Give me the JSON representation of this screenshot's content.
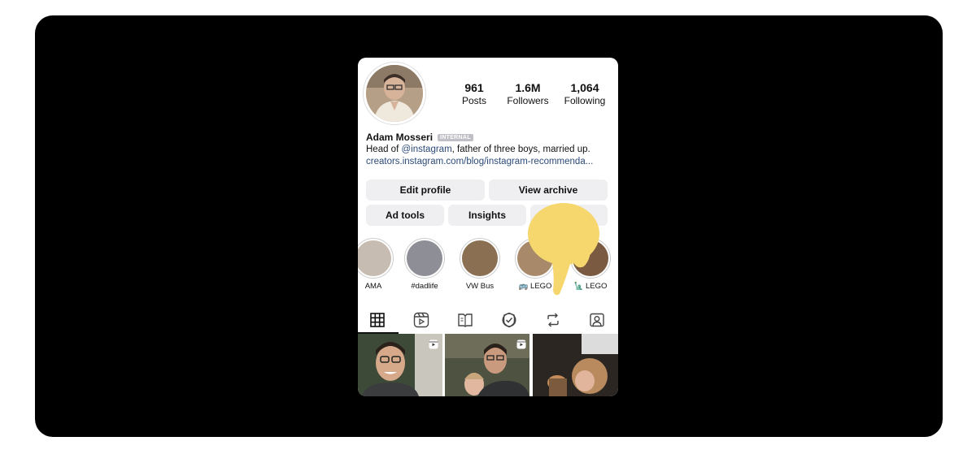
{
  "profile": {
    "name": "Adam Mosseri",
    "badge": "INTERNAL",
    "bio_prefix": "Head of ",
    "bio_mention": "@instagram",
    "bio_suffix": ", father of three boys, married up.",
    "link": "creators.instagram.com/blog/instagram-recommenda..."
  },
  "stats": [
    {
      "value": "961",
      "label": "Posts"
    },
    {
      "value": "1.6M",
      "label": "Followers"
    },
    {
      "value": "1,064",
      "label": "Following"
    }
  ],
  "buttons": {
    "edit_profile": "Edit profile",
    "view_archive": "View archive",
    "ad_tools": "Ad tools",
    "insights": "Insights"
  },
  "highlights": [
    {
      "label": "AMA"
    },
    {
      "label": "#dadlife"
    },
    {
      "label": "VW Bus"
    },
    {
      "label": "🚌 LEGO"
    },
    {
      "label": "🗽 LEGO"
    }
  ],
  "tabs": [
    "grid-icon",
    "reels-icon",
    "guides-icon",
    "collab-icon",
    "reposts-icon",
    "tagged-icon"
  ],
  "colors": {
    "link": "#2b4a78",
    "button_bg": "#efeff1",
    "pointer": "#f5d76e"
  }
}
